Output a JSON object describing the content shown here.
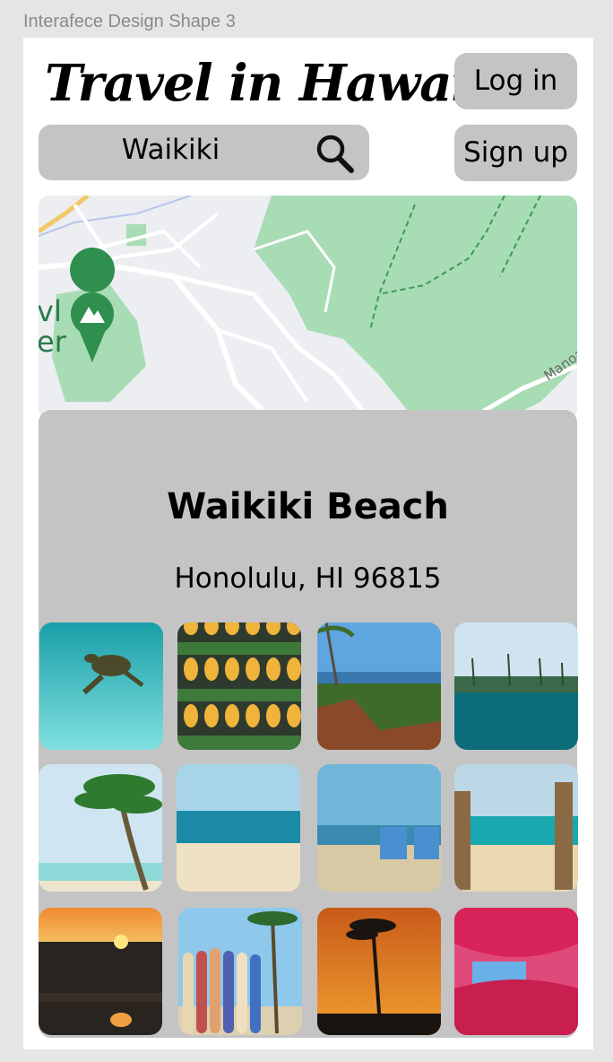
{
  "frame": {
    "label": "Interafece Design Shape 3"
  },
  "header": {
    "title": "Travel in Hawaii",
    "login_label": "Log in",
    "signup_label": "Sign up"
  },
  "search": {
    "value": "Waikiki",
    "icon": "search-icon"
  },
  "map": {
    "label_manoa": "Manoa",
    "marker": "park-marker-icon",
    "label_left_1": "vl",
    "label_left_2": "er"
  },
  "place": {
    "name": "Waikiki Beach",
    "address": "Honolulu, HI 96815"
  },
  "photos": [
    "sea-turtle-photo",
    "pineapples-photo",
    "coastal-deck-photo",
    "palm-underwater-photo",
    "palm-beach-photo",
    "beach-horizon-photo",
    "beach-chairs-photo",
    "beach-path-photo",
    "sunset-waves-photo",
    "surfboards-photo",
    "palm-sunset-photo",
    "pink-umbrellas-photo"
  ]
}
